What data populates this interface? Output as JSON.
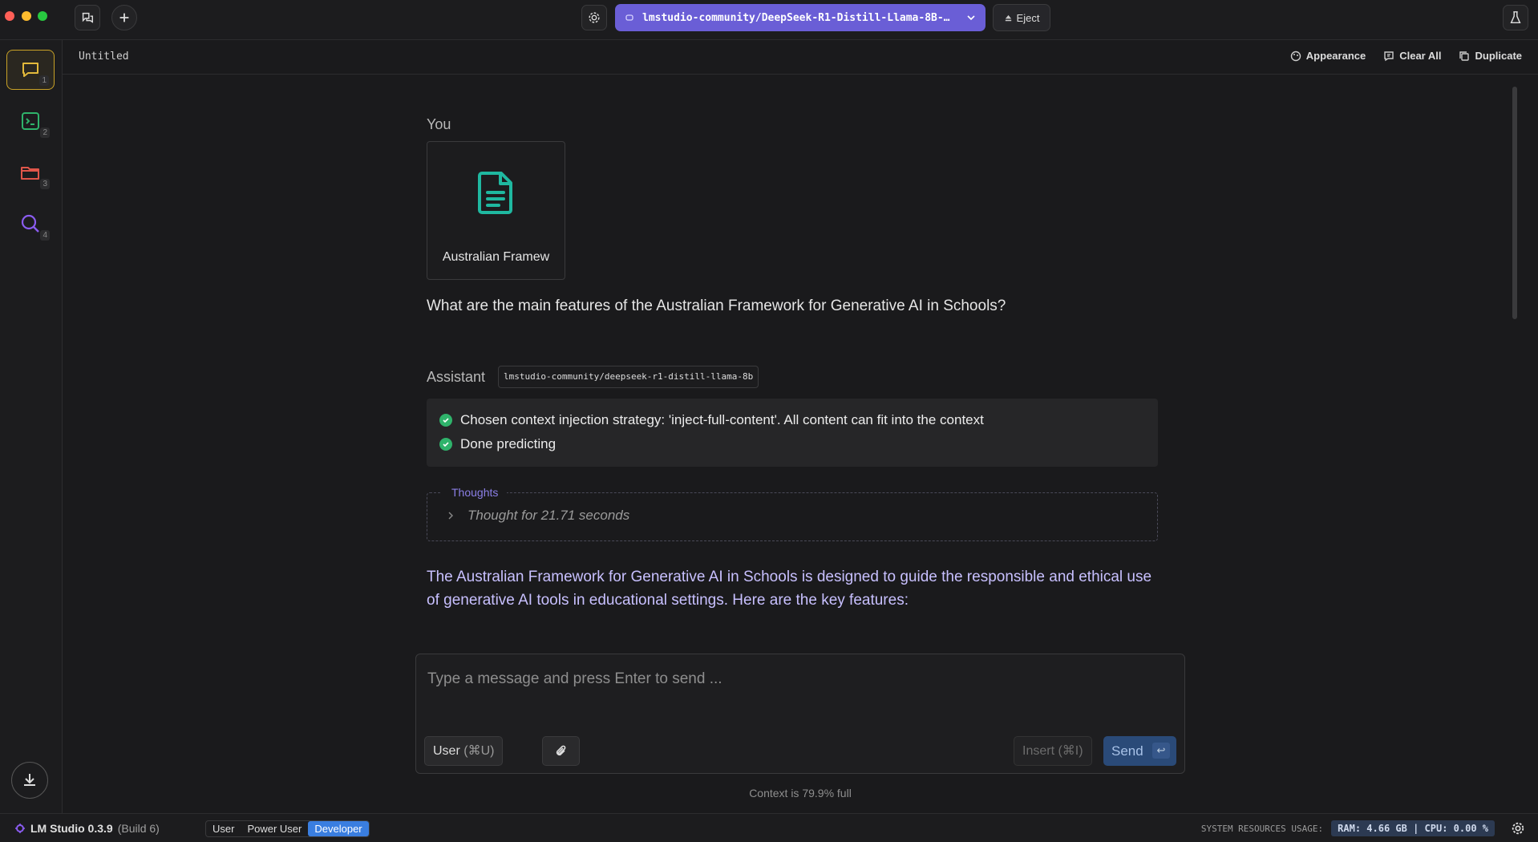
{
  "topbar": {
    "model_name": "lmstudio-community/DeepSeek-R1-Distill-Llama-8B-…",
    "eject_label": "Eject"
  },
  "sidebar": {
    "items": [
      {
        "name": "chat",
        "num": "1"
      },
      {
        "name": "developer",
        "num": "2"
      },
      {
        "name": "my-models",
        "num": "3"
      },
      {
        "name": "discover",
        "num": "4"
      }
    ]
  },
  "subheader": {
    "title": "Untitled",
    "appearance_label": "Appearance",
    "clear_all_label": "Clear All",
    "duplicate_label": "Duplicate"
  },
  "chat": {
    "user_role": "You",
    "attachment_name": "Australian Framew",
    "user_message": "What are the main features of the Australian Framework for Generative AI in Schools?",
    "assistant_role": "Assistant",
    "assistant_model": "lmstudio-community/deepseek-r1-distill-llama-8b",
    "status_lines": [
      "Chosen context injection strategy: 'inject-full-content'. All content can fit into the context",
      "Done predicting"
    ],
    "thoughts_label": "Thoughts",
    "thoughts_summary": "Thought for 21.71 seconds",
    "answer": "The Australian Framework for Generative AI in Schools is designed to guide the responsible and ethical use of generative AI tools in educational settings. Here are the key features:"
  },
  "composer": {
    "placeholder": "Type a message and press Enter to send ...",
    "role_label": "User",
    "role_shortcut": "(⌘U)",
    "insert_label": "Insert",
    "insert_shortcut": "(⌘I)",
    "send_label": "Send",
    "send_key": "↩",
    "context_note": "Context is 79.9% full"
  },
  "statusbar": {
    "app_name": "LM Studio 0.3.9",
    "build": "(Build 6)",
    "modes": [
      "User",
      "Power User",
      "Developer"
    ],
    "active_mode": "Developer",
    "resources_label": "SYSTEM RESOURCES USAGE:",
    "resources_value": "RAM: 4.66 GB | CPU: 0.00 %"
  },
  "colors": {
    "accent_model": "#6a5ed6",
    "active_sidebar": "#c9a227",
    "answer_text": "#c8c0ff",
    "mode_active": "#3a7ee0",
    "check": "#2fb36b"
  }
}
